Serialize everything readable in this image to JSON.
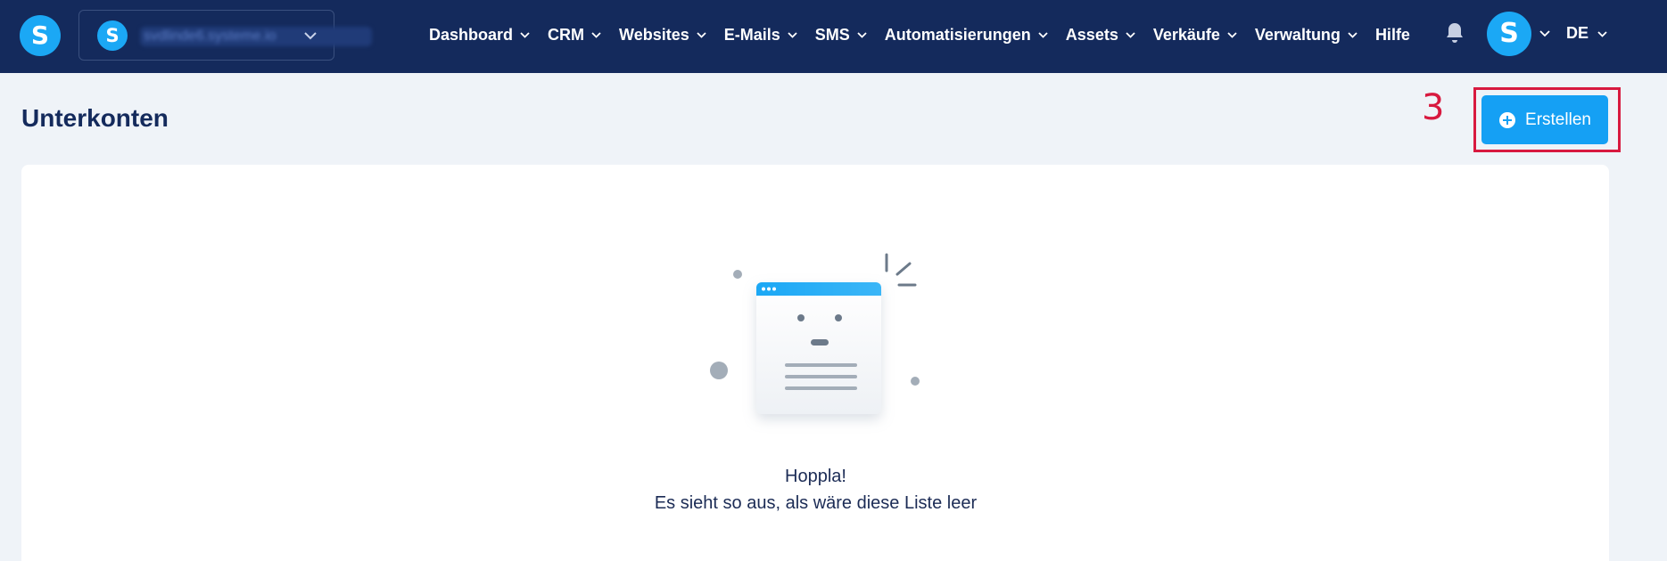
{
  "nav": {
    "logo_letter": "S",
    "account": {
      "letter": "S",
      "name": "svdlinde6.systeme.io"
    },
    "menu": [
      {
        "label": "Dashboard",
        "has_dropdown": true
      },
      {
        "label": "CRM",
        "has_dropdown": true
      },
      {
        "label": "Websites",
        "has_dropdown": true
      },
      {
        "label": "E-Mails",
        "has_dropdown": true
      },
      {
        "label": "SMS",
        "has_dropdown": true
      },
      {
        "label": "Automatisierungen",
        "has_dropdown": true
      },
      {
        "label": "Assets",
        "has_dropdown": true
      },
      {
        "label": "Verkäufe",
        "has_dropdown": true
      },
      {
        "label": "Verwaltung",
        "has_dropdown": true
      },
      {
        "label": "Hilfe",
        "has_dropdown": false
      }
    ],
    "bell_icon": "bell-icon",
    "avatar_letter": "S",
    "language": "DE"
  },
  "page": {
    "title": "Unterkonten",
    "annotation_number": "3",
    "create_label": "Erstellen"
  },
  "empty_state": {
    "title": "Hoppla!",
    "subtitle": "Es sieht so aus, als wäre diese Liste leer"
  },
  "colors": {
    "nav_bg": "#142a5c",
    "brand_blue": "#1ba8f5",
    "button_blue": "#15a0f4",
    "annotation_red": "#d8193f",
    "page_bg": "#eff3f8"
  }
}
